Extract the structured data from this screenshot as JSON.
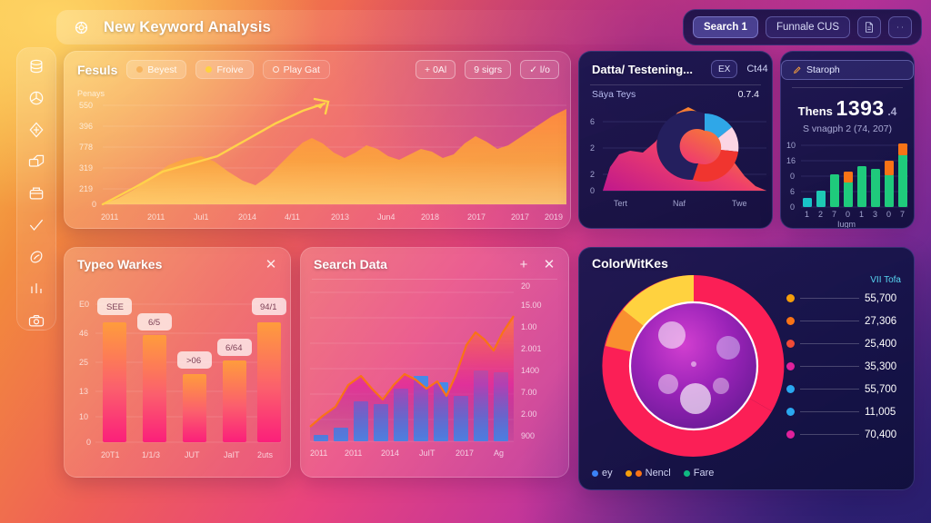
{
  "app": {
    "title": "New Keyword Analysis",
    "logo_icon": "app-logo-icon"
  },
  "topbar": {
    "search_label": "Search 1",
    "funnel_label": "Funnale CUS",
    "doc_icon": "document-icon",
    "more_icon": "more-options-icon"
  },
  "sidebar": {
    "items": [
      {
        "icon": "database-icon",
        "name": "sidebar-item-database"
      },
      {
        "icon": "pie-chart-icon",
        "name": "sidebar-item-analytics"
      },
      {
        "icon": "compass-icon",
        "name": "sidebar-item-explore"
      },
      {
        "icon": "box-icon",
        "name": "sidebar-item-packages"
      },
      {
        "icon": "archive-icon",
        "name": "sidebar-item-archive"
      },
      {
        "icon": "check-icon",
        "name": "sidebar-item-tasks"
      },
      {
        "icon": "tag-icon",
        "name": "sidebar-item-tags"
      },
      {
        "icon": "bar-chart-icon",
        "name": "sidebar-item-reports"
      },
      {
        "icon": "camera-icon",
        "name": "sidebar-item-media"
      }
    ]
  },
  "main_card": {
    "title": "Fesuls",
    "chips": [
      {
        "label": "Beyest",
        "color": "#f6b35c"
      },
      {
        "label": "Froive",
        "color": "#ffd23f"
      },
      {
        "label": "Play Gat",
        "color": "transparent"
      }
    ],
    "buttons": [
      {
        "label": "+ 0Al"
      },
      {
        "label": "9 sigrs"
      },
      {
        "label": "✓ l/o"
      }
    ]
  },
  "donut_card": {
    "title": "Datta/ Testening...",
    "badge": "EX",
    "meta": "Ct44",
    "row_label": "Säya Teys",
    "row_value": "0.7.4"
  },
  "kpi_card": {
    "button_label": "Staroph",
    "button_icon": "edit-icon",
    "prefix": "Thens",
    "value": "1393",
    "suffix": ".4",
    "subtitle": "S vnagph 2 (74, 207)"
  },
  "bars_card": {
    "title": "Typeo Warkes",
    "close_icon": "close-icon"
  },
  "combo_card": {
    "title": "Search Data",
    "add_icon": "plus-icon",
    "close_icon": "close-icon"
  },
  "big_card": {
    "title": "ColorWitKes",
    "legend_header": "VII Tofa",
    "footer_legend": [
      {
        "label": "ey",
        "colors": [
          "#3b82f6"
        ]
      },
      {
        "label": "Nencl",
        "colors": [
          "#f59e0b",
          "#f97316"
        ]
      },
      {
        "label": "Fare",
        "colors": [
          "#10b981"
        ]
      }
    ]
  },
  "chart_data": [
    {
      "id": "main-area-chart",
      "type": "area",
      "title": "Fesuls",
      "ylabel": "Penays",
      "ytick_labels": [
        "550",
        "396",
        "778",
        "319",
        "219",
        "0"
      ],
      "ylim": [
        0,
        550
      ],
      "xtick_labels": [
        "2011",
        "2011",
        "Jul1",
        "2014",
        "4/11",
        "2013",
        "Jun4",
        "2018",
        "2017",
        "2017",
        "2019"
      ],
      "grid": true,
      "series": [
        {
          "name": "area",
          "values": [
            5,
            60,
            95,
            150,
            210,
            235,
            200,
            150,
            125,
            175,
            230,
            300,
            275,
            240,
            230,
            265,
            300,
            285,
            250,
            230,
            255,
            290,
            270,
            250,
            245,
            255,
            300,
            360,
            400,
            430
          ]
        },
        {
          "name": "trend",
          "values": [
            10,
            80,
            160,
            235,
            270,
            300,
            345,
            420,
            470
          ]
        }
      ],
      "annotation": "upward trend arrow"
    },
    {
      "id": "donut-mini-chart",
      "type": "pie",
      "title": "Datta/ Testening...",
      "ytick_labels": [
        "6",
        "2",
        "2",
        "0"
      ],
      "xtick_labels": [
        "Tert",
        "Naf",
        "Twe"
      ],
      "slices": [
        {
          "label": "blue",
          "value": 22,
          "color": "#2fa7e8"
        },
        {
          "label": "pink",
          "value": 18,
          "color": "#fbd5e4"
        },
        {
          "label": "red",
          "value": 30,
          "color": "#f0352f"
        },
        {
          "label": "navy",
          "value": 30,
          "color": "#241f5e"
        }
      ],
      "overlay": {
        "type": "area",
        "values": [
          0,
          8,
          18,
          38,
          55,
          62,
          58,
          64,
          80,
          95,
          88,
          70,
          52,
          36,
          22,
          10,
          4
        ]
      }
    },
    {
      "id": "kpi-stacked-bars",
      "type": "bar",
      "stacked": true,
      "xlabel": "Iugm",
      "ytick_labels": [
        "10",
        "16",
        "0",
        "6",
        "0"
      ],
      "categories": [
        "1",
        "2",
        "7",
        "0",
        "1",
        "3",
        "0",
        "7"
      ],
      "series": [
        {
          "name": "base",
          "color": "#19c3c8",
          "values": [
            2,
            5,
            10,
            6,
            13,
            12,
            9,
            17
          ]
        },
        {
          "name": "top",
          "color": "#f97316",
          "values": [
            0,
            0,
            0,
            3,
            0,
            0,
            4,
            3
          ]
        }
      ],
      "ylim": [
        0,
        22
      ]
    },
    {
      "id": "typeo-warkes-bars",
      "type": "bar",
      "title": "Typeo Warkes",
      "ytick_labels": [
        "E0",
        "46",
        "25",
        "13",
        "10",
        "0"
      ],
      "categories": [
        "20T1",
        "1/1/3",
        "JUT",
        "JaIT",
        "2uts"
      ],
      "values": [
        50,
        42,
        30,
        35,
        52
      ],
      "data_labels": [
        "SEE",
        "6/5",
        ">06",
        "6/64",
        "94/1"
      ],
      "ylim": [
        0,
        60
      ]
    },
    {
      "id": "search-data-combo",
      "type": "bar",
      "title": "Search Data",
      "ytick_labels": [
        "20",
        "15.00",
        "1.00",
        "2.001",
        "1400",
        "7.00",
        "2.00",
        "900"
      ],
      "categories": [
        "2011",
        "2011",
        "2014",
        "JuIT",
        "2017",
        "Ag"
      ],
      "series": [
        {
          "name": "bars",
          "color": "#3b8ef0",
          "values": [
            4,
            9,
            22,
            20,
            30,
            42,
            36,
            26,
            46,
            44,
            52
          ]
        },
        {
          "name": "line",
          "color": "#f97316",
          "values": [
            8,
            14,
            30,
            46,
            40,
            52,
            48,
            42,
            64,
            58,
            72
          ]
        }
      ],
      "ylim": [
        0,
        80
      ]
    },
    {
      "id": "colorwitkes-donut",
      "type": "pie",
      "title": "ColorWitKes",
      "legend_title": "VII Tofa",
      "slices": [
        {
          "value": "55,700",
          "color": "#f59e0b"
        },
        {
          "value": "27,306",
          "color": "#f97316"
        },
        {
          "value": "25,400",
          "color": "#f04a36"
        },
        {
          "value": "35,300",
          "color": "#e0219b"
        },
        {
          "value": "55,700",
          "color": "#2aa8f0"
        },
        {
          "value": "11,005",
          "color": "#2aa8f0"
        },
        {
          "value": "70,400",
          "color": "#e0219b"
        }
      ]
    }
  ]
}
